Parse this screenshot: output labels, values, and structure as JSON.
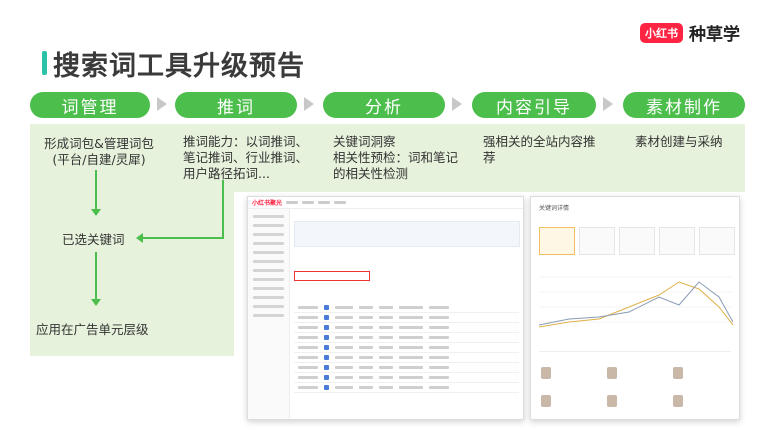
{
  "header": {
    "title": "搜索词工具升级预告",
    "brand_badge": "小红书",
    "brand_text": "种草学"
  },
  "steps": [
    {
      "label": "词管理"
    },
    {
      "label": "推词"
    },
    {
      "label": "分析"
    },
    {
      "label": "内容引导"
    },
    {
      "label": "素材制作"
    }
  ],
  "descriptions": {
    "word_mgmt_line1": "形成词包&管理词包",
    "word_mgmt_line2": "(平台/自建/灵犀)",
    "selected_keywords": "已选关键词",
    "apply_level": "应用在广告单元层级",
    "recommend_line1": "推词能力：以词推词、",
    "recommend_line2": "笔记推词、行业推词、",
    "recommend_line3": "用户路径拓词...",
    "analysis_line1": "关键词洞察",
    "analysis_line2": "相关性预检：词和笔记",
    "analysis_line3": "的相关性检测",
    "content_line1": "强相关的全站内容推",
    "content_line2": "荐",
    "material_line1": "素材创建与采纳"
  },
  "colors": {
    "accent_green": "#4cbe4c",
    "panel_bg": "#e6f2dc",
    "title_bar": "#2bc3a8",
    "brand_red": "#ff2442"
  },
  "screenshots": {
    "left_logo": "小红书聚光",
    "right_title": "关键词详情"
  }
}
